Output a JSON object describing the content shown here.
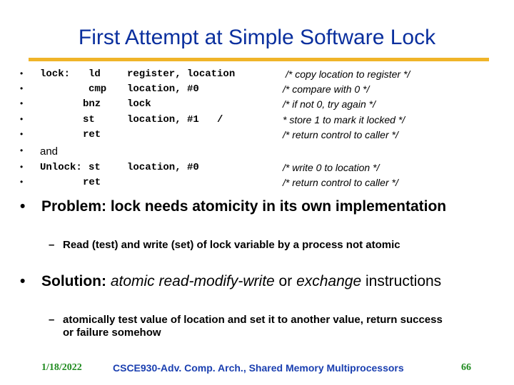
{
  "slide": {
    "title": "First Attempt at Simple Software Lock",
    "accent_rule_color": "#f0b429",
    "title_color": "#0a2f9e"
  },
  "code": [
    {
      "bullet": "•",
      "label": "lock:",
      "op": "ld",
      "args": "register, location",
      "comment": "/* copy location to register */"
    },
    {
      "bullet": "•",
      "label": "",
      "op": "cmp",
      "args": "location, #0",
      "comment": "/* compare with 0 */"
    },
    {
      "bullet": "•",
      "label": "",
      "op": "bnz",
      "args": "lock",
      "comment": "/* if not 0, try again */"
    },
    {
      "bullet": "•",
      "label": "",
      "op": "st",
      "args": "location, #1   /",
      "comment": "* store 1 to mark it locked */"
    },
    {
      "bullet": "•",
      "label": "",
      "op": "ret",
      "args": "",
      "comment": "/* return control to caller */"
    },
    {
      "bullet": "•",
      "plain": "and"
    },
    {
      "bullet": "•",
      "label": "Unlock:",
      "op": "st",
      "args": "location, #0",
      "comment": "/* write 0 to location */"
    },
    {
      "bullet": "•",
      "label": "",
      "op": "ret",
      "args": "",
      "comment": "/* return control to caller */"
    }
  ],
  "bullets": {
    "problem": {
      "marker": "•",
      "text": "Problem: lock needs atomicity in its own implementation",
      "sub": {
        "marker": "–",
        "text": "Read (test) and write (set) of lock variable by a process not atomic"
      }
    },
    "solution": {
      "marker": "•",
      "prefix": "Solution: ",
      "em1": "atomic read-modify-write",
      "mid": " or ",
      "em2": "exchange",
      "suffix": " instructions",
      "sub": {
        "marker": "–",
        "text": "atomically test value of location and set it to another value, return success or failure somehow"
      }
    }
  },
  "footer": {
    "date": "1/18/2022",
    "course": "CSCE930-Adv. Comp. Arch., Shared Memory Multiprocessors",
    "page": "66"
  }
}
